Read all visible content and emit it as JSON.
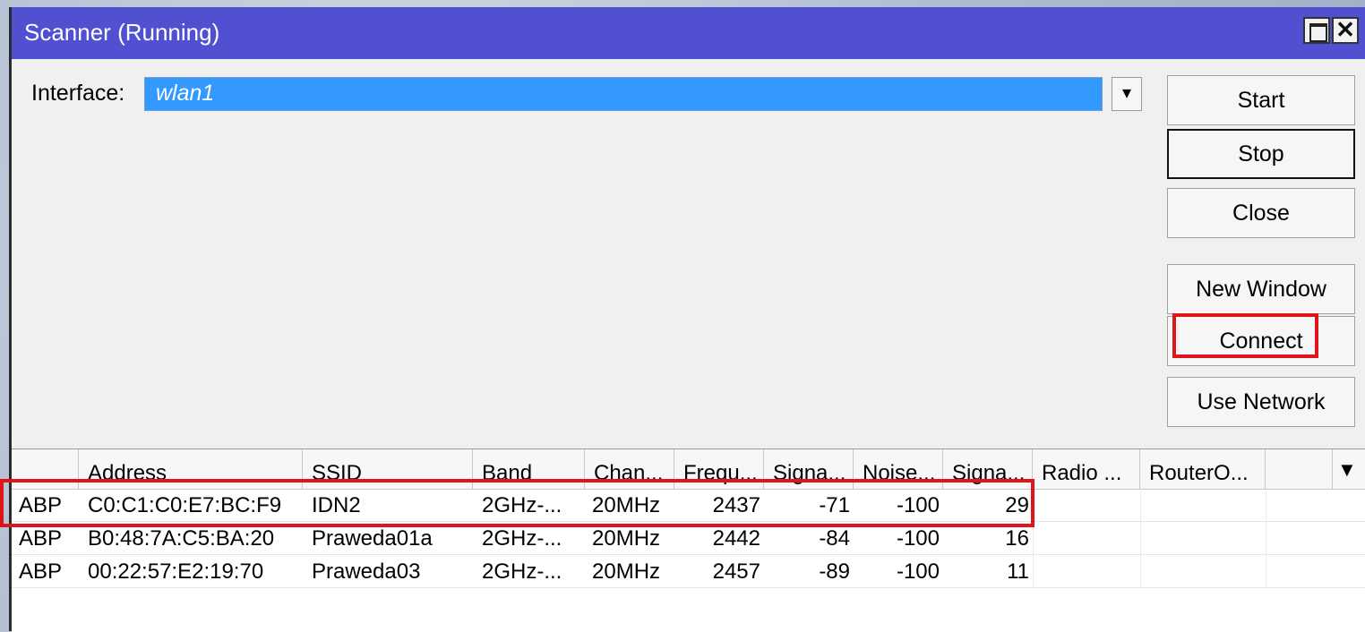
{
  "window": {
    "title": "Scanner (Running)",
    "maximize_icon": "maximize-icon",
    "close_icon": "close-icon",
    "close_glyph": "✕",
    "accent": "#5050d0"
  },
  "interface": {
    "label": "Interface:",
    "value": "wlan1",
    "dropdown_glyph": "▾"
  },
  "buttons": {
    "start": "Start",
    "stop": "Stop",
    "close": "Close",
    "new_window": "New Window",
    "connect": "Connect",
    "use_network": "Use Network"
  },
  "highlight_color": "#e0151b",
  "table": {
    "columns": [
      "",
      "Address",
      "SSID",
      "Band",
      "Chan...",
      "Frequ...",
      "Signa...",
      "Noise...",
      "Signa...",
      "Radio ...",
      "RouterO...",
      ""
    ],
    "column_menu_glyph": "▼",
    "rows": [
      {
        "flags": "ABP",
        "address": "C0:C1:C0:E7:BC:F9",
        "ssid": "IDN2",
        "band": "2GHz-...",
        "channel": "20MHz",
        "frequency": "2437",
        "signal": "-71",
        "noise": "-100",
        "snr": "29"
      },
      {
        "flags": "ABP",
        "address": "B0:48:7A:C5:BA:20",
        "ssid": "Praweda01a",
        "band": "2GHz-...",
        "channel": "20MHz",
        "frequency": "2442",
        "signal": "-84",
        "noise": "-100",
        "snr": "16"
      },
      {
        "flags": "ABP",
        "address": "00:22:57:E2:19:70",
        "ssid": "Praweda03",
        "band": "2GHz-...",
        "channel": "20MHz",
        "frequency": "2457",
        "signal": "-89",
        "noise": "-100",
        "snr": "11"
      }
    ]
  }
}
